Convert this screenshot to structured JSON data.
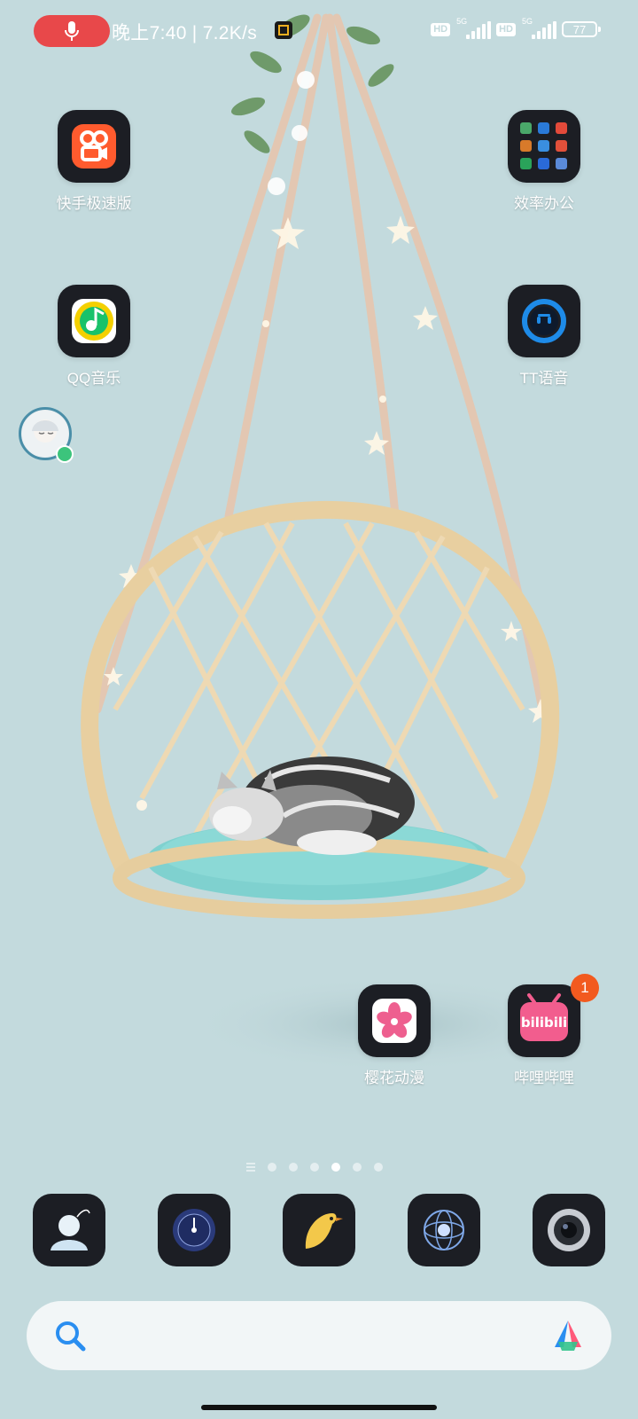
{
  "status_bar": {
    "time_speed": "晚上7:40 | 7.2K/s",
    "sim1": {
      "hd": "HD",
      "net": "5G"
    },
    "sim2": {
      "hd": "HD",
      "net": "5G"
    },
    "battery": "77"
  },
  "home_apps": [
    {
      "label": "快手极速版",
      "icon": "kuaishou-lite-icon"
    },
    {
      "label": "效率办公",
      "icon": "folder-icon"
    },
    {
      "label": "QQ音乐",
      "icon": "qq-music-icon"
    },
    {
      "label": "TT语音",
      "icon": "tt-voice-icon"
    },
    {
      "label": "樱花动漫",
      "icon": "sakura-anime-icon"
    },
    {
      "label": "哔哩哔哩",
      "icon": "bilibili-icon",
      "badge": "1"
    }
  ],
  "bilibili_logo_text": "bilibili",
  "page_indicator": {
    "pages": 6,
    "active_index": 3
  },
  "dock": [
    {
      "icon": "contacts-icon"
    },
    {
      "icon": "compass-icon"
    },
    {
      "icon": "bird-app-icon"
    },
    {
      "icon": "orbit-app-icon"
    },
    {
      "icon": "camera-icon"
    }
  ],
  "search_bar": {
    "icon": "search-icon",
    "assistant": "assistant-icon"
  },
  "colors": {
    "wallpaper": "#c3dadd",
    "mic_pill": "#e8484a",
    "badge": "#f25a1f",
    "icon_bg": "#1c1e24"
  }
}
